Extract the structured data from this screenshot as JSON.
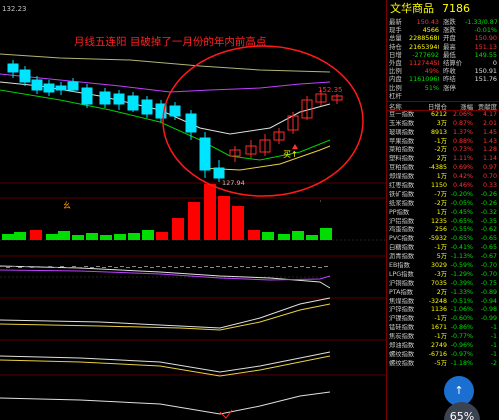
{
  "chart": {
    "price_top_label": "132.23",
    "annotation": "月线五连阳 目破掉了一月份的年内前高点",
    "high_label": "152.35",
    "low_label": "127.94",
    "buy_label": "买↑",
    "marker_label": "幺",
    "colors": {
      "up": "#ff2a2a",
      "down": "#00e5ff",
      "vol_up": "#ff0000",
      "vol_down": "#00dd00",
      "circle": "#ff1a1a",
      "ma_purple": "#c040ff",
      "ma_olive": "#b4b478",
      "ma_green": "#00d000",
      "ma_white": "#e0e0e0",
      "ma_yellow": "#e8d040"
    }
  },
  "panel": {
    "title": "文华商品",
    "code": "7186",
    "quote_rows": [
      {
        "k1": "最新",
        "v1": "150.43",
        "c1": "red",
        "k2": "涨跌",
        "v2": "-1.33/0.87%",
        "c2": "green"
      },
      {
        "k1": "现手",
        "v1": "4566",
        "c1": "yellow",
        "k2": "涨跌",
        "v2": "-0.01%",
        "c2": "green"
      },
      {
        "k1": "总量",
        "v1": "22885688",
        "c1": "yellow",
        "k2": "开盘",
        "v2": "150.90",
        "c2": "red"
      },
      {
        "k1": "持仓",
        "v1": "21653940",
        "c1": "yellow",
        "k2": "最高",
        "v2": "151.13",
        "c2": "red"
      },
      {
        "k1": "日增",
        "v1": "-277692",
        "c1": "green",
        "k2": "最低",
        "v2": "149.55",
        "c2": "green"
      },
      {
        "k1": "外盘",
        "v1": "11274458",
        "c1": "red",
        "k2": "结算价",
        "v2": "0",
        "c2": "white"
      },
      {
        "k1": "比例",
        "v1": "49%",
        "c1": "red",
        "k2": "昨收",
        "v2": "150.91",
        "c2": "white"
      },
      {
        "k1": "内盘",
        "v1": "11610968",
        "c1": "green",
        "k2": "昨结",
        "v2": "151.76",
        "c2": "white"
      },
      {
        "k1": "比例",
        "v1": "51%",
        "c1": "green",
        "k2": "涨停",
        "v2": "",
        "c2": "white"
      },
      {
        "k1": "杠杆",
        "v1": "",
        "c1": "white",
        "k2": "",
        "v2": "",
        "c2": "white"
      }
    ],
    "list_header": {
      "name": "名称",
      "volume": "日增仓",
      "change": "涨幅",
      "contrib": "贡献度"
    },
    "list_rows": [
      {
        "name": "豆一指数",
        "vol": "6212",
        "chg": "2.06%",
        "chgc": "red",
        "con": "4.17",
        "conc": "red"
      },
      {
        "name": "玉米指数",
        "vol": "3万",
        "chg": "0.87%",
        "chgc": "red",
        "con": "2.01",
        "conc": "red"
      },
      {
        "name": "玻璃指数",
        "vol": "8913",
        "chg": "1.37%",
        "chgc": "red",
        "con": "1.45",
        "conc": "red"
      },
      {
        "name": "苹果指数",
        "vol": "-1万",
        "chg": "0.88%",
        "chgc": "red",
        "con": "1.43",
        "conc": "red"
      },
      {
        "name": "菜粕指数",
        "vol": "-2万",
        "chg": "0.73%",
        "chgc": "red",
        "con": "1.28",
        "conc": "red"
      },
      {
        "name": "塑料指数",
        "vol": "2万",
        "chg": "1.11%",
        "chgc": "red",
        "con": "1.14",
        "conc": "red"
      },
      {
        "name": "豆粕指数",
        "vol": "-4385",
        "chg": "0.69%",
        "chgc": "red",
        "con": "0.97",
        "conc": "red"
      },
      {
        "name": "郑煤指数",
        "vol": "1万",
        "chg": "0.42%",
        "chgc": "red",
        "con": "0.70",
        "conc": "red"
      },
      {
        "name": "红枣指数",
        "vol": "1150",
        "chg": "0.46%",
        "chgc": "red",
        "con": "0.33",
        "conc": "red"
      },
      {
        "name": "铁矿指数",
        "vol": "-7万",
        "chg": "-0.20%",
        "chgc": "green",
        "con": "-0.26",
        "conc": "green"
      },
      {
        "name": "纸浆指数",
        "vol": "-2万",
        "chg": "-0.05%",
        "chgc": "green",
        "con": "-0.26",
        "conc": "green"
      },
      {
        "name": "PP指数",
        "vol": "1万",
        "chg": "-0.45%",
        "chgc": "green",
        "con": "-0.32",
        "conc": "green"
      },
      {
        "name": "沪铝指数",
        "vol": "1235",
        "chg": "-0.65%",
        "chgc": "green",
        "con": "-0.35",
        "conc": "green"
      },
      {
        "name": "鸡蛋指数",
        "vol": "256",
        "chg": "-0.55%",
        "chgc": "green",
        "con": "-0.62",
        "conc": "green"
      },
      {
        "name": "PVC指数",
        "vol": "-5932",
        "chg": "-0.65%",
        "chgc": "green",
        "con": "-0.65",
        "conc": "green"
      },
      {
        "name": "白糖指数",
        "vol": "-1万",
        "chg": "-0.41%",
        "chgc": "green",
        "con": "-0.65",
        "conc": "green"
      },
      {
        "name": "沥青指数",
        "vol": "5万",
        "chg": "-1.13%",
        "chgc": "green",
        "con": "-0.67",
        "conc": "green"
      },
      {
        "name": "EB指数",
        "vol": "3029",
        "chg": "-0.59%",
        "chgc": "green",
        "con": "-0.70",
        "conc": "green"
      },
      {
        "name": "LPG指数",
        "vol": "-3万",
        "chg": "-1.29%",
        "chgc": "green",
        "con": "-0.70",
        "conc": "green"
      },
      {
        "name": "沪铜指数",
        "vol": "7035",
        "chg": "-0.39%",
        "chgc": "green",
        "con": "-0.75",
        "conc": "green"
      },
      {
        "name": "PTA指数",
        "vol": "2万",
        "chg": "-1.33%",
        "chgc": "green",
        "con": "-0.89",
        "conc": "green"
      },
      {
        "name": "焦煤指数",
        "vol": "-3248",
        "chg": "-0.51%",
        "chgc": "green",
        "con": "-0.94",
        "conc": "green"
      },
      {
        "name": "沪锌指数",
        "vol": "1136",
        "chg": "-1.06%",
        "chgc": "green",
        "con": "-0.98",
        "conc": "green"
      },
      {
        "name": "沪镍指数",
        "vol": "-1万",
        "chg": "-0.60%",
        "chgc": "green",
        "con": "-0.99",
        "conc": "green"
      },
      {
        "name": "锰硅指数",
        "vol": "1671",
        "chg": "-0.86%",
        "chgc": "green",
        "con": "-1",
        "conc": "green"
      },
      {
        "name": "焦炭指数",
        "vol": "-1万",
        "chg": "-0.77%",
        "chgc": "green",
        "con": "-1",
        "conc": "green"
      },
      {
        "name": "郑油指数",
        "vol": "2749",
        "chg": "-0.96%",
        "chgc": "green",
        "con": "-1",
        "conc": "green"
      },
      {
        "name": "螺纹指数",
        "vol": "-6716",
        "chg": "-0.97%",
        "chgc": "green",
        "con": "-1",
        "conc": "green"
      },
      {
        "name": "螺纹指数",
        "vol": "-5万",
        "chg": "-1.18%",
        "chgc": "green",
        "con": "-2",
        "conc": "green"
      }
    ]
  },
  "bubble": {
    "label": "65%"
  },
  "bubble_top": {
    "label": "↑"
  }
}
